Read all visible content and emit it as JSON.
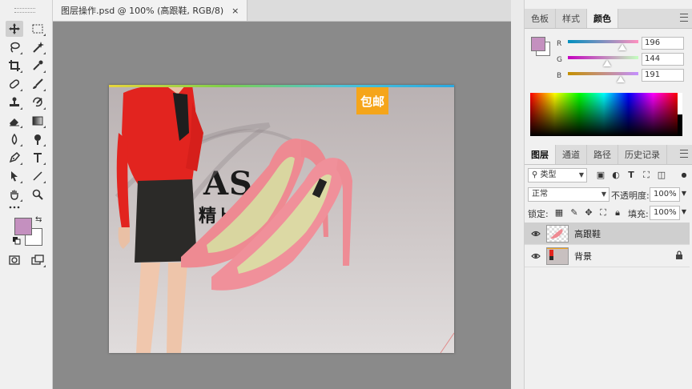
{
  "document": {
    "tab_title": "图层操作.psd @ 100% (高跟鞋, RGB/8)",
    "close_glyph": "×"
  },
  "toolbar": {
    "tools": [
      "move-tool",
      "marquee-tool",
      "lasso-tool",
      "magic-wand-tool",
      "crop-tool",
      "eyedropper-tool",
      "healing-brush-tool",
      "brush-tool",
      "clone-stamp-tool",
      "history-brush-tool",
      "eraser-tool",
      "gradient-tool",
      "blur-tool",
      "dodge-tool",
      "pen-tool",
      "type-tool",
      "path-selection-tool",
      "line-tool",
      "hand-tool",
      "zoom-tool",
      "more-tools",
      "quick-mask",
      "screen-mode"
    ],
    "foreground_color": "#c490bf",
    "background_color": "#ffffff"
  },
  "canvas": {
    "badge_text": "包邮",
    "brand_text": "AS",
    "brand_subtext": "精ト"
  },
  "color_panel": {
    "tabs": [
      "色板",
      "样式",
      "颜色"
    ],
    "active_tab": "颜色",
    "channels": [
      {
        "label": "R",
        "value": "196",
        "fraction": 0.77
      },
      {
        "label": "G",
        "value": "144",
        "fraction": 0.56
      },
      {
        "label": "B",
        "value": "191",
        "fraction": 0.75
      }
    ],
    "current_color": "#c490bf"
  },
  "layers_panel": {
    "tabs": [
      "图层",
      "通道",
      "路径",
      "历史记录"
    ],
    "active_tab": "图层",
    "filter_label": "类型",
    "blend_mode": "正常",
    "opacity_label": "不透明度:",
    "opacity_value": "100%",
    "lock_label": "锁定:",
    "fill_label": "填充:",
    "fill_value": "100%",
    "layers": [
      {
        "name": "高跟鞋",
        "selected": true,
        "locked": false
      },
      {
        "name": "背景",
        "selected": false,
        "locked": true
      }
    ]
  }
}
